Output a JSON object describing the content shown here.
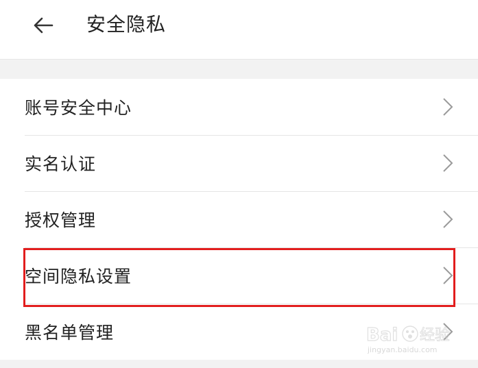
{
  "header": {
    "title": "安全隐私",
    "back_icon": "arrow-left-icon"
  },
  "menu": {
    "items": [
      {
        "label": "账号安全中心",
        "icon": "chevron-right-icon"
      },
      {
        "label": "实名认证",
        "icon": "chevron-right-icon"
      },
      {
        "label": "授权管理",
        "icon": "chevron-right-icon"
      },
      {
        "label": "空间隐私设置",
        "icon": "chevron-right-icon",
        "highlighted": true
      },
      {
        "label": "黑名单管理",
        "icon": "chevron-right-icon"
      }
    ]
  },
  "annotation": {
    "highlight_color": "#e21d1d"
  },
  "watermark": {
    "brand": "Baidu经验",
    "url": "jingyan.baidu.com"
  }
}
